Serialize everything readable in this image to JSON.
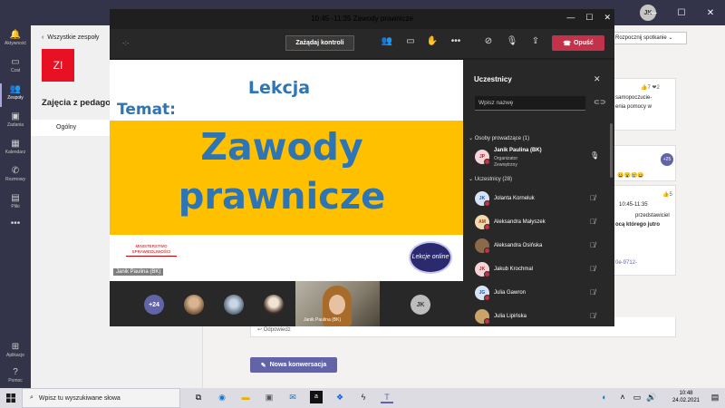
{
  "teams": {
    "user_initials": "JK"
  },
  "rail": [
    {
      "label": "Aktywność",
      "icon": "bell-icon"
    },
    {
      "label": "Czat",
      "icon": "chat-icon"
    },
    {
      "label": "Zespoły",
      "icon": "teams-icon"
    },
    {
      "label": "Zadania",
      "icon": "assignments-icon"
    },
    {
      "label": "Kalendarz",
      "icon": "calendar-icon"
    },
    {
      "label": "Rozmowy",
      "icon": "calls-icon"
    },
    {
      "label": "Pliki",
      "icon": "files-icon"
    },
    {
      "label": "Aplikacje",
      "icon": "apps-icon"
    },
    {
      "label": "Pomoc",
      "icon": "help-icon"
    }
  ],
  "team_panel": {
    "back_label": "Wszystkie zespoły",
    "logo_initials": "ZI",
    "team_name": "Zajęcia z pedagog",
    "channel": "Ogólny"
  },
  "background": {
    "start_meeting": "Rozpocznij spotkanie",
    "reactions": "7",
    "heart_count": "2",
    "snippet1": "samopoczucie-",
    "snippet2": "enia pomocy w",
    "plus_count": "+25",
    "like_count": "5",
    "snippet3": "10:45-11:35",
    "snippet4": "przedstawiciel",
    "snippet5": "ocą którego jutro",
    "snippet6": "0e-9712-",
    "reply": "Odpowiedz",
    "new_conversation": "Nowa konwersacja"
  },
  "meeting": {
    "title": "10:45 -11:35 Zawody prawnicze",
    "request_control": "Zażądaj kontroli",
    "hangup": "Opuść",
    "slide": {
      "lekcja": "Lekcja",
      "temat": "Temat:",
      "title_line1": "Zawody",
      "title_line2": "prawnicze",
      "ministry_line1": "MINISTERSTWO",
      "ministry_line2": "SPRAWIEDLIWOŚCI",
      "badge": "Lekcje online"
    },
    "presenter_label": "Janik Paulina (BK)",
    "gallery": {
      "more": "+24",
      "self_label": "Janik Paulina (BK)",
      "last_initials": "JK"
    }
  },
  "participants": {
    "title": "Uczestnicy",
    "search_placeholder": "Wpisz nazwę",
    "presenters_header": "Osoby prowadzące (1)",
    "organizer": {
      "initials": "JP",
      "name": "Janik Paulina (BK)",
      "role1": "Organizator",
      "role2": "Zewnętrzny"
    },
    "attendees_header": "Uczestnicy (28)",
    "attendees": [
      {
        "initials": "JK",
        "name": "Jolanta Korneluk",
        "color": "#d6e4f5",
        "text": "#2b579a"
      },
      {
        "initials": "AM",
        "name": "Aleksandra Małyszek",
        "color": "#f3d9b1",
        "text": "#8a4b00"
      },
      {
        "initials": "",
        "name": "Aleksandra Osińska",
        "color": "#8a6a4a",
        "text": "#fff"
      },
      {
        "initials": "JK",
        "name": "Jakub Krochmal",
        "color": "#f6d5d9",
        "text": "#a4262c"
      },
      {
        "initials": "JG",
        "name": "Julia Gawron",
        "color": "#d6e4f5",
        "text": "#2b579a"
      },
      {
        "initials": "",
        "name": "Julia Lipińska",
        "color": "#c9a46a",
        "text": "#fff"
      }
    ]
  },
  "taskbar": {
    "search_placeholder": "Wpisz tu wyszukiwane słowa",
    "time": "10:48",
    "date": "24.02.2021"
  }
}
